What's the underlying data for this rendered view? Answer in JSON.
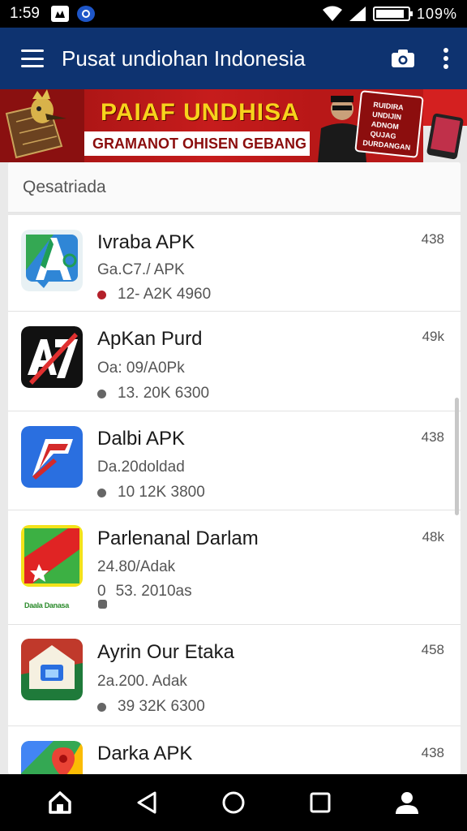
{
  "status_bar": {
    "time": "1:59",
    "battery_percent_text": "109%",
    "battery_level": 0.9,
    "icons": [
      "notification-icon",
      "app-notification-icon",
      "wifi-icon",
      "signal-icon",
      "battery-icon"
    ]
  },
  "app_bar": {
    "title": "Pusat undiohan Indonesia",
    "icons": [
      "menu-icon",
      "camera-icon",
      "more-vert-icon"
    ],
    "color": "#0e3370"
  },
  "banner": {
    "title": "PAIAF UNDHISA",
    "subtitle": "GRAMANOT OHISEN GEBANG",
    "promo_lines": [
      "RUIDIRA",
      "UNDIJIN",
      "ADNOM",
      "QUJAG",
      "DURDANGAN"
    ]
  },
  "search": {
    "placeholder": "Qesatriada"
  },
  "apps": [
    {
      "name": "Ivraba APK",
      "subtitle": "Ga.C7./ APK",
      "stats": "12- A2K 4960",
      "size": "438",
      "dot_color": "red",
      "icon": "android-studio-icon"
    },
    {
      "name": "ApKan Purd",
      "subtitle": "Oa: 09/A0Pk",
      "stats": "13. 20K 6300",
      "size": "49k",
      "dot_color": "gray",
      "icon": "a7-app-icon"
    },
    {
      "name": "Dalbi APK",
      "subtitle": "Da.20doldad",
      "stats": "10 12K 3800",
      "size": "438",
      "dot_color": "gray",
      "icon": "flag-app-icon"
    },
    {
      "name": "Parlenanal Darlam",
      "subtitle": "24.80/Adak",
      "stats": "53. 2010as",
      "stats_prefix": "0",
      "size": "48k",
      "dot_color": "gray",
      "icon": "red-flag-app-icon",
      "icon_caption": "Daala Danasa"
    },
    {
      "name": "Ayrin Our Etaka",
      "subtitle": "2a.200. Adak",
      "stats": "39 32K 6300",
      "size": "458",
      "dot_color": "gray",
      "icon": "house-app-icon"
    },
    {
      "name": "Darka APK",
      "subtitle": "",
      "stats": "",
      "size": "438",
      "dot_color": "gray",
      "icon": "maps-app-icon"
    }
  ],
  "nav_bar": {
    "buttons": [
      "home-icon",
      "back-icon",
      "recents-circle-icon",
      "overview-square-icon",
      "profile-icon"
    ]
  }
}
